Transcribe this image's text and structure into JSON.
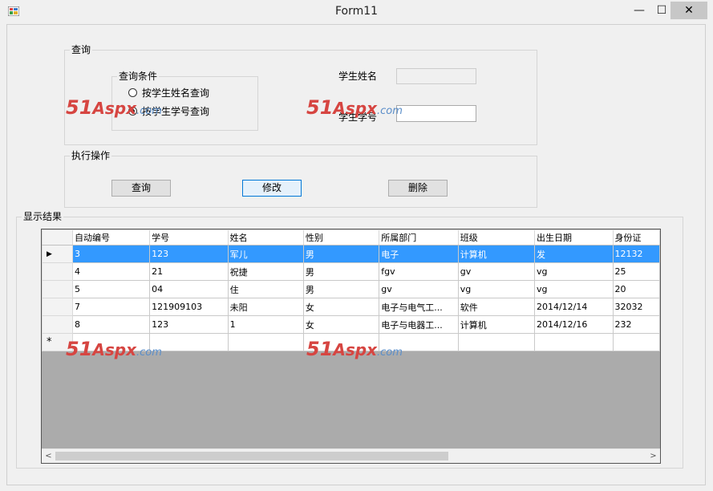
{
  "window": {
    "title": "Form11",
    "min_glyph": "—",
    "max_glyph": "☐",
    "close_glyph": "✕"
  },
  "query_group": {
    "label": "查询",
    "conditions": {
      "label": "查询条件",
      "options": [
        {
          "label": "按学生姓名查询",
          "checked": false
        },
        {
          "label": "按学生学号查询",
          "checked": true
        }
      ]
    },
    "name_label": "学生姓名",
    "name_value": "",
    "id_label": "学生学号",
    "id_value": ""
  },
  "action_group": {
    "label": "执行操作",
    "buttons": {
      "query": "查询",
      "modify": "修改",
      "delete": "删除"
    }
  },
  "result_group": {
    "label": "显示结果",
    "columns": [
      "自动编号",
      "学号",
      "姓名",
      "性别",
      "所属部门",
      "班级",
      "出生日期",
      "身份证"
    ],
    "rows": [
      [
        "3",
        "123",
        "军儿",
        "男",
        "电子",
        "计算机",
        "发",
        "12132"
      ],
      [
        "4",
        "21",
        "祝捷",
        "男",
        "fgv",
        "gv",
        "vg",
        "25"
      ],
      [
        "5",
        "04",
        "住",
        "男",
        "gv",
        "vg",
        "vg",
        "20"
      ],
      [
        "7",
        "121909103",
        "未阳",
        "女",
        "电子与电气工...",
        "软件",
        "2014/12/14",
        "32032"
      ],
      [
        "8",
        "123",
        "1",
        "女",
        "电子与电器工...",
        "计算机",
        "2014/12/16",
        "232"
      ]
    ],
    "selected_row": 0,
    "current_row_marker": "▶",
    "new_row_marker": "*",
    "scroll_left": "<",
    "scroll_right": ">"
  },
  "watermark": {
    "number": "51",
    "brand": "Aspx",
    "suffix": ".com"
  },
  "colors": {
    "selection": "#3399ff",
    "watermark_red": "#d64541",
    "watermark_blue": "#5b8ec9"
  }
}
